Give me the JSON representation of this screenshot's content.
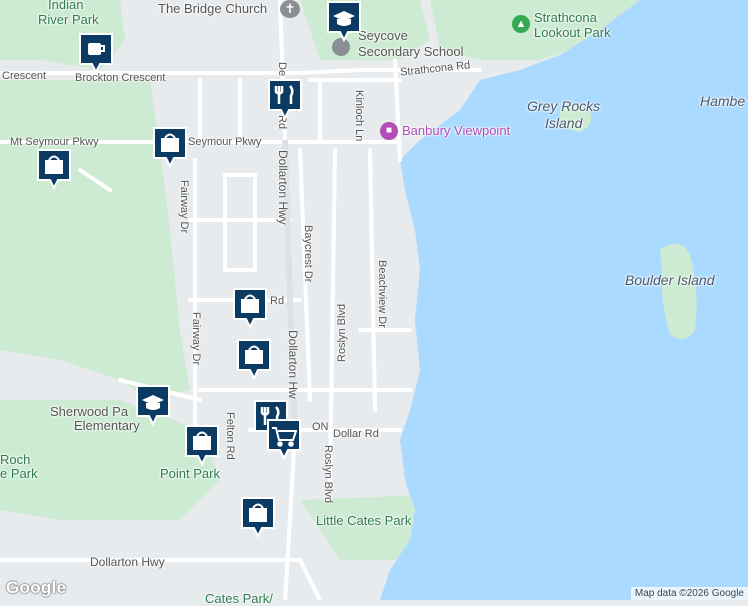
{
  "map": {
    "attribution": "Map data ©2026 Google",
    "logo": "Google",
    "colors": {
      "water": "#aadaff",
      "park": "#cdebd2",
      "land": "#e8ebee",
      "road": "#ffffff",
      "marker": "#0b3a63"
    }
  },
  "labels": {
    "indian_river_park_1": "Indian",
    "indian_river_park_2": "River Park",
    "bridge_church": "The Bridge Church",
    "seycove_1": "Seycove",
    "seycove_2": "Secondary School",
    "strathcona_1": "Strathcona",
    "strathcona_2": "Lookout Park",
    "strathcona_rd": "Strathcona Rd",
    "brockton_crescent_1": "Crescent",
    "brockton_crescent_2": "Brockton Crescent",
    "kinloch_ln": "Kinloch Ln",
    "grey_rocks_1": "Grey Rocks",
    "grey_rocks_2": "Island",
    "hamber": "Hambe",
    "banbury": "Banbury Viewpoint",
    "mt_seymour_pkwy_1": "Mt Seymour Pkwy",
    "mt_seymour_pkwy_2": "Seymour Pkwy",
    "deep_cove_rd": "De",
    "deep_cove_rd_2": "Rd",
    "dollarton_hwy_1": "Dollarton Hwy",
    "dollarton_hwy_2": "Dollarton Hw",
    "dollarton_hwy_3": "Dollarton Hwy",
    "baycrest_dr": "Baycrest Dr",
    "beachview_dr": "Beachview Dr",
    "boulder_island": "Boulder Island",
    "fairway_dr_1": "Fairway Dr",
    "fairway_dr_2": "Fairway Dr",
    "roslyn_blvd_1": "Roslyn Blvd",
    "roslyn_blvd_2": "Roslyn Blvd",
    "rd_small": "Rd",
    "sherwood_1": "Sherwood Pa",
    "sherwood_2": "Elementary",
    "felton_rd": "Felton Rd",
    "dollar_rd": "Dollar Rd",
    "on": "ON",
    "roche_1": "Roch",
    "roche_2": "e Park",
    "roche_3": "Point Park",
    "little_cates_park": "Little Cates Park",
    "cates_park": "Cates Park/"
  },
  "markers": [
    {
      "name": "cafe-marker",
      "icon": "coffee-cup-icon"
    },
    {
      "name": "school-marker-top",
      "icon": "graduation-cap-icon"
    },
    {
      "name": "restaurant-marker-top",
      "icon": "fork-knife-icon"
    },
    {
      "name": "shopping-marker-1",
      "icon": "shopping-bag-icon"
    },
    {
      "name": "shopping-marker-2",
      "icon": "shopping-bag-icon"
    },
    {
      "name": "shopping-marker-3",
      "icon": "shopping-bag-icon"
    },
    {
      "name": "shopping-marker-4",
      "icon": "shopping-bag-icon"
    },
    {
      "name": "school-marker-sherwood",
      "icon": "graduation-cap-icon"
    },
    {
      "name": "restaurant-marker-bottom",
      "icon": "fork-knife-icon"
    },
    {
      "name": "grocery-marker",
      "icon": "shopping-cart-icon"
    },
    {
      "name": "shopping-marker-5",
      "icon": "shopping-bag-icon"
    },
    {
      "name": "shopping-marker-6",
      "icon": "shopping-bag-icon"
    }
  ]
}
